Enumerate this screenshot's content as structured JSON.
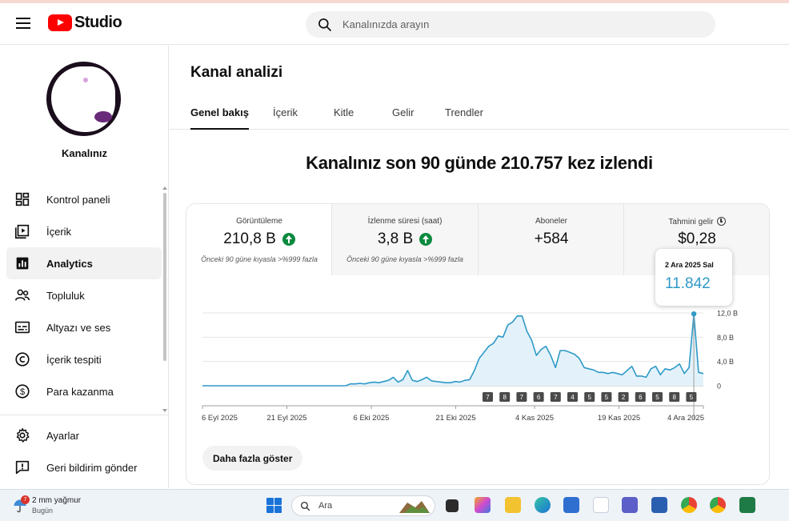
{
  "header": {
    "logo_text": "Studio",
    "search_placeholder": "Kanalınızda arayın"
  },
  "sidebar": {
    "channel_name": "Kanalınız",
    "items": [
      {
        "label": "Kontrol paneli",
        "icon": "dashboard-icon"
      },
      {
        "label": "İçerik",
        "icon": "content-icon"
      },
      {
        "label": "Analytics",
        "icon": "analytics-icon",
        "active": true
      },
      {
        "label": "Topluluk",
        "icon": "community-icon"
      },
      {
        "label": "Altyazı ve ses",
        "icon": "subtitles-icon"
      },
      {
        "label": "İçerik tespiti",
        "icon": "copyright-icon"
      },
      {
        "label": "Para kazanma",
        "icon": "monetization-icon"
      }
    ],
    "bottom_items": [
      {
        "label": "Ayarlar",
        "icon": "settings-icon"
      },
      {
        "label": "Geri bildirim gönder",
        "icon": "feedback-icon"
      }
    ]
  },
  "main": {
    "title": "Kanal analizi",
    "tabs": [
      "Genel bakış",
      "İçerik",
      "Kitle",
      "Gelir",
      "Trendler"
    ],
    "active_tab": "Genel bakış",
    "headline": "Kanalınız son 90 günde 210.757 kez izlendi",
    "metrics": [
      {
        "label": "Görüntüleme",
        "value": "210,8 B",
        "note": "Önceki 90 güne kıyasla >%999 fazla",
        "trend": "up"
      },
      {
        "label": "İzlenme süresi (saat)",
        "value": "3,8 B",
        "note": "Önceki 90 güne kıyasla >%999 fazla",
        "trend": "up"
      },
      {
        "label": "Aboneler",
        "value": "+584"
      },
      {
        "label": "Tahmini gelir",
        "value": "$0,28"
      }
    ],
    "tooltip": {
      "date": "2 Ara 2025 Sal",
      "value": "11.842"
    },
    "more_button": "Daha fazla göster"
  },
  "chart_data": {
    "type": "area",
    "series": [
      {
        "values": [
          0,
          0,
          0,
          0,
          0,
          0,
          0,
          0,
          0,
          0,
          0,
          0,
          0,
          0,
          0,
          0,
          0,
          0,
          0,
          0,
          0,
          0,
          0,
          0,
          0,
          0,
          0,
          0,
          0,
          0,
          0,
          300,
          300,
          400,
          300,
          500,
          600,
          500,
          700,
          900,
          1400,
          600,
          1000,
          2500,
          900,
          700,
          1000,
          1400,
          800,
          700,
          600,
          500,
          500,
          700,
          600,
          900,
          1000,
          2500,
          4500,
          5500,
          6500,
          7000,
          8200,
          8000,
          10000,
          10500,
          11500,
          11500,
          9000,
          7500,
          5000,
          6000,
          6500,
          5000,
          3000,
          5800,
          5800,
          5500,
          5200,
          4500,
          3000,
          2800,
          2600,
          2200,
          2200,
          2000,
          2200,
          2000,
          1800,
          2500,
          3200,
          1600,
          1600,
          1400,
          2800,
          3200,
          1800,
          2800,
          2600,
          3000,
          3600,
          2000,
          3000,
          11842,
          2200,
          2000
        ]
      }
    ],
    "x_tick_labels": [
      "6 Eyl 2025",
      "21 Eyl 2025",
      "6 Eki 2025",
      "21 Eki 2025",
      "4 Kas 2025",
      "19 Kas 2025",
      "4 Ara 2025"
    ],
    "y_tick_labels": [
      "12,0 B",
      "8,0 B",
      "4,0 B",
      "0"
    ],
    "ylim": [
      0,
      12000
    ],
    "markers": [
      "7",
      "8",
      "7",
      "6",
      "7",
      "4",
      "5",
      "5",
      "2",
      "6",
      "5",
      "8",
      "5"
    ],
    "colors": {
      "line": "#2f99c7",
      "fill": "#e3f2fa",
      "accent": "#ff0000",
      "up": "#0b8a3e"
    }
  },
  "taskbar": {
    "weather_title": "2 mm yağmur",
    "weather_sub": "Bugün",
    "weather_badge": "7",
    "search_label": "Ara"
  }
}
